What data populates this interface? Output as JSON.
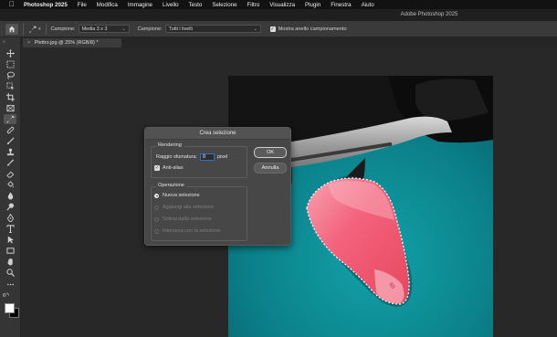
{
  "menubar": {
    "app_name": "Photoshop 2025",
    "items": [
      "File",
      "Modifica",
      "Immagine",
      "Livello",
      "Testo",
      "Selezione",
      "Filtro",
      "Visualizza",
      "Plugin",
      "Finestra",
      "Aiuto"
    ]
  },
  "window": {
    "title": "Adobe Photoshop 2025"
  },
  "options": {
    "sample_label": "Campione:",
    "sample_value": "Media 3 x 3",
    "sample2_label": "Campione:",
    "sample2_value": "Tutti i livelli",
    "ring_label": "Mostra anello campionamento",
    "ring_checked": true
  },
  "document": {
    "tab_label": "Plettro.jpg @ 25% (RGB/8) *"
  },
  "dialog": {
    "title": "Crea selezione",
    "ok_label": "OK",
    "cancel_label": "Annulla",
    "rendering": {
      "title": "Rendering",
      "feather_label": "Raggio sfumatura:",
      "feather_value": "0",
      "feather_unit": "pixel",
      "antialias_label": "Anti-alias",
      "antialias_checked": true
    },
    "operation": {
      "title": "Operazione",
      "options": [
        "Nuova selezione",
        "Aggiungi alla selezione",
        "Sottrai dalla selezione",
        "Interseca con la selezione"
      ],
      "selected": "Nuova selezione"
    }
  },
  "toolbar": {
    "tools": [
      "move-tool",
      "marquee-tool",
      "lasso-tool",
      "object-select-tool",
      "crop-tool",
      "frame-tool",
      "eyedropper-tool",
      "healing-brush-tool",
      "brush-tool",
      "clone-stamp-tool",
      "history-brush-tool",
      "eraser-tool",
      "gradient-tool",
      "blur-tool",
      "dodge-tool",
      "pen-tool",
      "type-tool",
      "path-select-tool",
      "rectangle-tool",
      "hand-tool",
      "zoom-tool",
      "more-tools"
    ],
    "foreground_color": "#ffffff",
    "background_color": "#000000"
  },
  "colors": {
    "accent_blue": "#2f6fd6",
    "teal_background": "#0f8a92",
    "pick_pink": "#f05a74"
  }
}
